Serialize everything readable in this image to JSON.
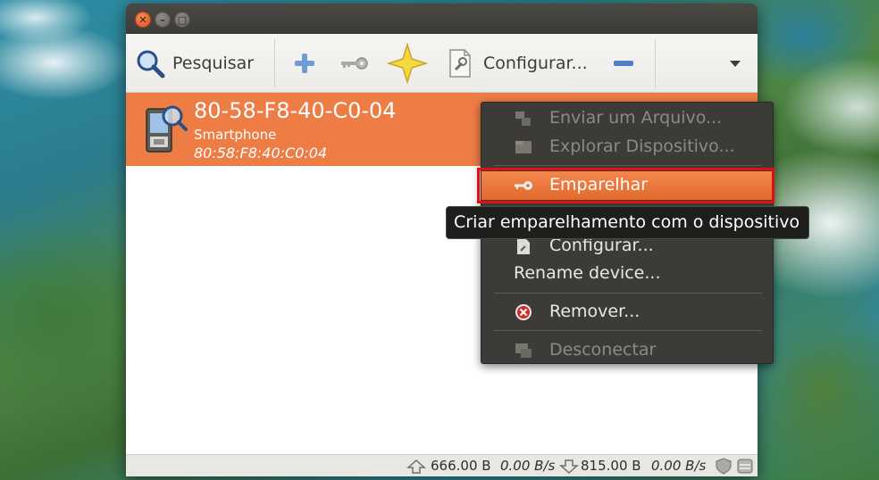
{
  "toolbar": {
    "search_label": "Pesquisar",
    "configure_label": "Configurar..."
  },
  "device": {
    "name": "80-58-F8-40-C0-04",
    "type": "Smartphone",
    "mac": "80:58:F8:40:C0:04"
  },
  "context_menu": {
    "items": [
      {
        "label": "Enviar um Arquivo...",
        "enabled": false,
        "icon": "send-file-icon"
      },
      {
        "label": "Explorar Dispositivo...",
        "enabled": false,
        "icon": "browse-device-icon"
      },
      {
        "label": "Emparelhar",
        "enabled": true,
        "highlighted": true,
        "icon": "key-icon"
      },
      {
        "label": "Configurar...",
        "enabled": true,
        "icon": "configure-icon"
      },
      {
        "label": "Rename device...",
        "enabled": true
      },
      {
        "label": "Remover...",
        "enabled": true,
        "icon": "remove-icon"
      },
      {
        "label": "Desconectar",
        "enabled": false,
        "icon": "disconnect-icon"
      }
    ]
  },
  "tooltip": {
    "text": "Criar emparelhamento com o dispositivo"
  },
  "statusbar": {
    "upload_total": "666.00 B",
    "upload_rate": "0.00 B/s",
    "download_total": "815.00 B",
    "download_rate": "0.00 B/s"
  },
  "colors": {
    "selection": "#ee7c45",
    "menu_bg": "#3c3b37",
    "highlight_outline": "#e01010"
  }
}
